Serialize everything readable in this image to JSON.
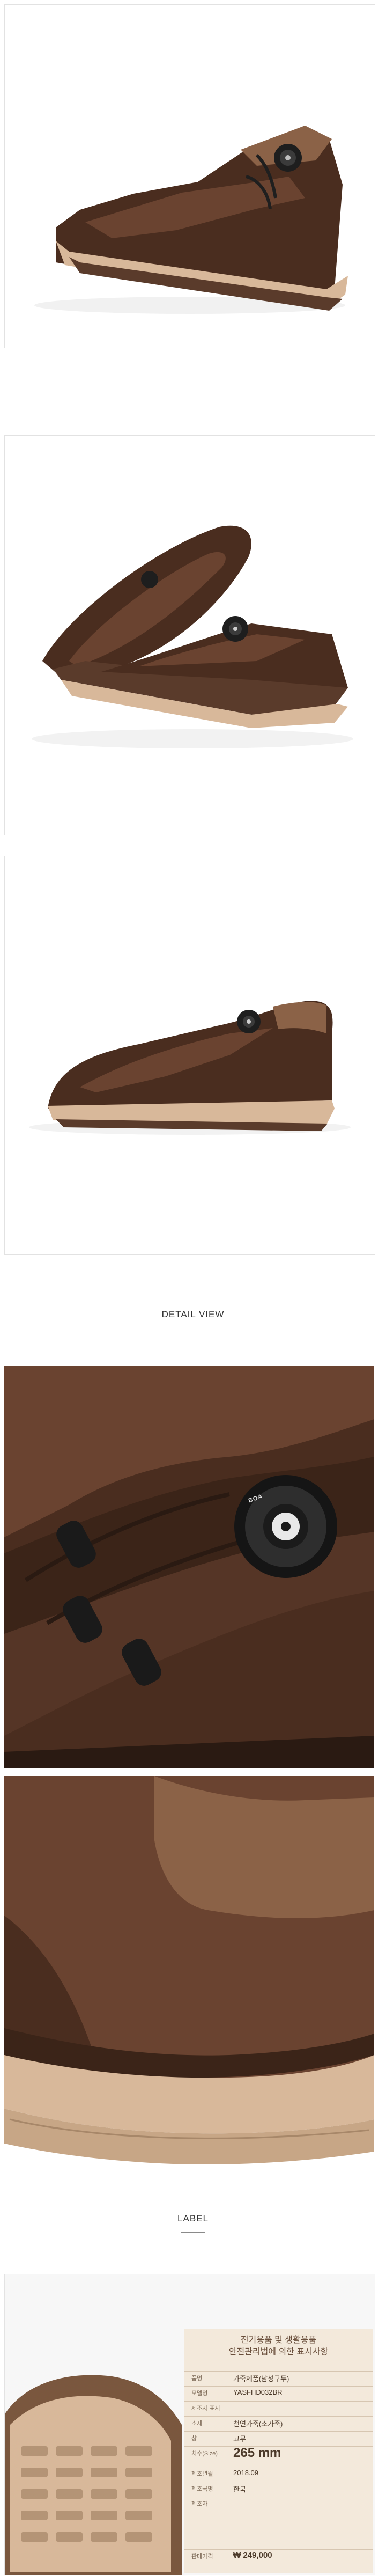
{
  "sections": {
    "detail_title": "DETAIL VIEW",
    "label_title": "LABEL"
  },
  "images": {
    "side_view": "shoe-side-view",
    "top_view": "shoe-top-view",
    "profile_view": "shoe-profile-view",
    "dial_closeup": "dial-closeup",
    "heel_closeup": "heel-closeup",
    "sole_view": "sole-view",
    "care_label": "care-label"
  },
  "brand": {
    "logo_letters": "BOA"
  },
  "label": {
    "header_line1": "전기용품 및 생활용품",
    "header_line2": "안전관리법에 의한 표시사항",
    "rows": [
      {
        "key": "품명",
        "value": "가죽제품(남성구두)"
      },
      {
        "key": "모델명",
        "value": "YASFHD032BR"
      },
      {
        "key": "제조자 표시",
        "value": ""
      },
      {
        "key": "소재",
        "value": "천연가죽(소가죽)"
      },
      {
        "key": "창",
        "value": "고무"
      },
      {
        "key": "치수(Size)",
        "value": "265 mm"
      },
      {
        "key": "제조년월",
        "value": "2018.09"
      },
      {
        "key": "제조국명",
        "value": "한국"
      },
      {
        "key": "제조자",
        "value": ""
      },
      {
        "key": "판매가격",
        "value": "₩ 249,000"
      }
    ]
  },
  "colors": {
    "leather_dark": "#4a2d1f",
    "leather_mid": "#6a4330",
    "leather_light": "#8b6247",
    "sole_beige": "#d8b89a",
    "sole_dark": "#5a3b2b",
    "label_bg": "#f3e9db"
  }
}
